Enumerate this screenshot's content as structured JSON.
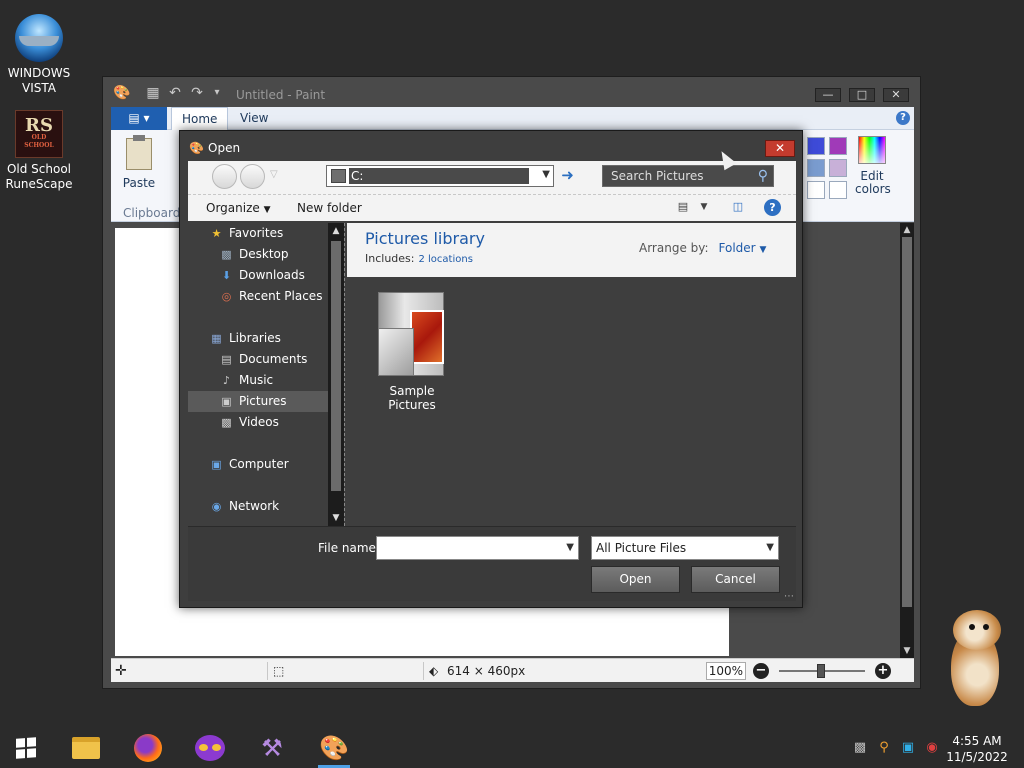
{
  "desktop": {
    "icons": [
      {
        "label": "WINDOWS\nVISTA"
      },
      {
        "label": "Old School\nRuneScape"
      }
    ],
    "rs_badge": "RS",
    "rs_subtitle": "OLD SCHOOL"
  },
  "paint": {
    "title": "Untitled - Paint",
    "tabs": [
      "Home",
      "View"
    ],
    "paste_label": "Paste",
    "clipboard_group": "Clipboard",
    "edit_colors": "Edit\ncolors",
    "swatch_colors": [
      "#3e4bd8",
      "#a03ab8",
      "#7a9ccf",
      "#c8b0d8",
      "#ffffff",
      "#ffffff",
      "#ffffff",
      "#ffffff"
    ],
    "status": {
      "size": "614 × 460px",
      "zoom": "100%"
    }
  },
  "dialog": {
    "title": "Open",
    "address": "C:",
    "search_placeholder": "Search Pictures",
    "toolbar": {
      "organize": "Organize",
      "new_folder": "New folder"
    },
    "nav": [
      {
        "label": "Favorites",
        "icon": "star-icon",
        "level": 0
      },
      {
        "label": "Desktop",
        "icon": "desktop-icon",
        "level": 1
      },
      {
        "label": "Downloads",
        "icon": "downloads-icon",
        "level": 1
      },
      {
        "label": "Recent Places",
        "icon": "recent-places-icon",
        "level": 1
      },
      {
        "label": "Libraries",
        "icon": "libraries-icon",
        "level": 0
      },
      {
        "label": "Documents",
        "icon": "documents-icon",
        "level": 1
      },
      {
        "label": "Music",
        "icon": "music-icon",
        "level": 1
      },
      {
        "label": "Pictures",
        "icon": "pictures-icon",
        "level": 1,
        "selected": true
      },
      {
        "label": "Videos",
        "icon": "videos-icon",
        "level": 1
      },
      {
        "label": "Computer",
        "icon": "computer-icon",
        "level": 0
      },
      {
        "label": "Network",
        "icon": "network-icon",
        "level": 0
      }
    ],
    "library": {
      "title": "Pictures library",
      "includes_label": "Includes:",
      "locations": "2 locations",
      "arrange_label": "Arrange by:",
      "arrange_value": "Folder"
    },
    "items": [
      {
        "label": "Sample Pictures"
      }
    ],
    "file_name_label": "File name:",
    "file_name_value": "",
    "file_type": "All Picture Files",
    "open_button": "Open",
    "cancel_button": "Cancel"
  },
  "taskbar": {
    "apps": [
      "windows-start",
      "file-explorer",
      "firefox",
      "incognito-browser",
      "visual-studio",
      "paint"
    ],
    "clock_time": "4:55 AM",
    "clock_date": "11/5/2022"
  }
}
